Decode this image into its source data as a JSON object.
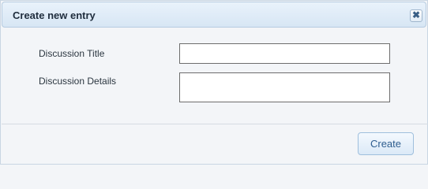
{
  "dialog": {
    "title": "Create new entry",
    "close_glyph": "✖",
    "close_icon": "close-icon"
  },
  "form": {
    "title_label": "Discussion Title",
    "title_value": "",
    "details_label": "Discussion Details",
    "details_value": ""
  },
  "footer": {
    "create_label": "Create"
  }
}
